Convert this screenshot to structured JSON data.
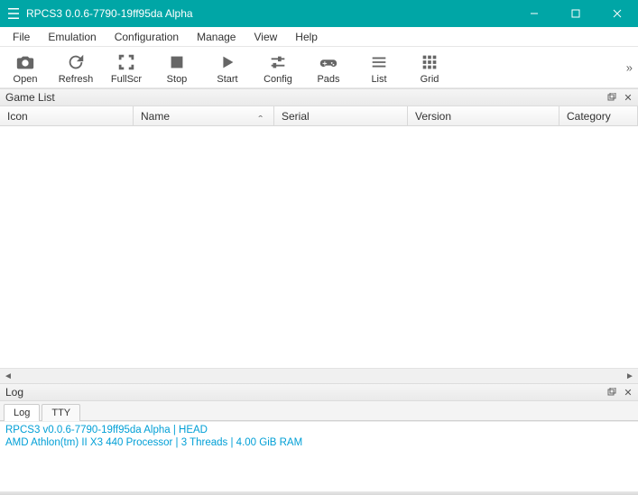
{
  "window": {
    "title": "RPCS3 0.0.6-7790-19ff95da Alpha"
  },
  "menus": [
    "File",
    "Emulation",
    "Configuration",
    "Manage",
    "View",
    "Help"
  ],
  "toolbar": [
    {
      "id": "open",
      "label": "Open"
    },
    {
      "id": "refresh",
      "label": "Refresh"
    },
    {
      "id": "fullscr",
      "label": "FullScr"
    },
    {
      "id": "stop",
      "label": "Stop"
    },
    {
      "id": "start",
      "label": "Start"
    },
    {
      "id": "config",
      "label": "Config"
    },
    {
      "id": "pads",
      "label": "Pads"
    },
    {
      "id": "list",
      "label": "List"
    },
    {
      "id": "grid",
      "label": "Grid"
    }
  ],
  "panels": {
    "gamelist_title": "Game List",
    "log_title": "Log"
  },
  "columns": [
    "Icon",
    "Name",
    "Serial",
    "Version",
    "Category"
  ],
  "log_tabs": [
    "Log",
    "TTY"
  ],
  "log_lines": {
    "l1": "RPCS3 v0.0.6-7790-19ff95da Alpha | HEAD",
    "l2": "AMD Athlon(tm) II X3 440 Processor | 3 Threads | 4.00 GiB RAM"
  }
}
